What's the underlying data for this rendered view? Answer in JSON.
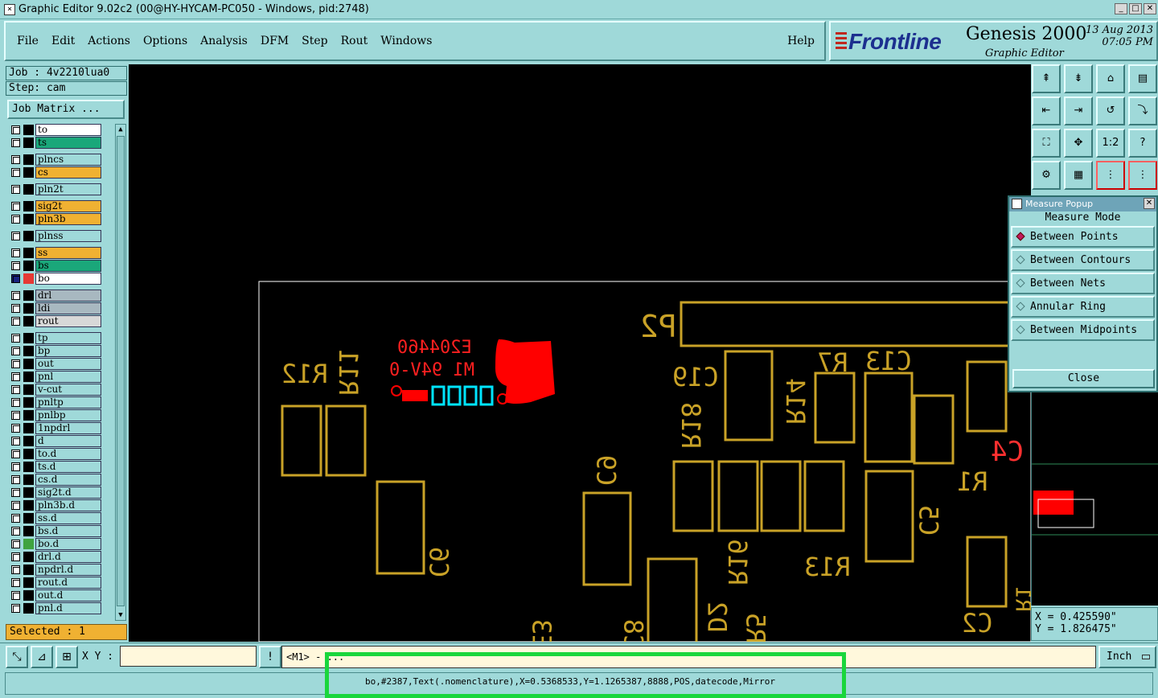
{
  "window": {
    "title": "Graphic Editor 9.02c2 (00@HY-HYCAM-PC050 - Windows, pid:2748)",
    "buttons": [
      "_",
      "□",
      "✕"
    ]
  },
  "menu": {
    "items": [
      "File",
      "Edit",
      "Actions",
      "Options",
      "Analysis",
      "DFM",
      "Step",
      "Rout",
      "Windows"
    ],
    "help": "Help"
  },
  "brand": {
    "logo": "Frontline",
    "product": "Genesis 2000",
    "subtitle": "Graphic Editor",
    "date": "13 Aug 2013",
    "time": "07:05 PM"
  },
  "job": {
    "job_line": "Job : 4v2210lua0",
    "step_line": "Step: cam",
    "matrix_button": "Job Matrix ..."
  },
  "layers": [
    {
      "name": "to",
      "color": "#ffffff"
    },
    {
      "name": "ts",
      "color": "#1aa77a"
    },
    {
      "name": "plncs",
      "color": "#9fd9d9"
    },
    {
      "name": "cs",
      "color": "#f0b132"
    },
    {
      "name": "pln2t",
      "color": "#9fd9d9"
    },
    {
      "name": "sig2t",
      "color": "#f0b132"
    },
    {
      "name": "pln3b",
      "color": "#f0b132"
    },
    {
      "name": "plnss",
      "color": "#9fd9d9"
    },
    {
      "name": "ss",
      "color": "#f0b132"
    },
    {
      "name": "bs",
      "color": "#1aa77a"
    },
    {
      "name": "bo",
      "color": "#ffffff",
      "active": true
    },
    {
      "name": "drl",
      "color": "#a8b8c0"
    },
    {
      "name": "ldi",
      "color": "#a8b8c0"
    },
    {
      "name": "rout",
      "color": "#d8d8d8"
    },
    {
      "name": "tp",
      "color": "#9fd9d9"
    },
    {
      "name": "bp",
      "color": "#9fd9d9"
    },
    {
      "name": "out",
      "color": "#9fd9d9"
    },
    {
      "name": "pnl",
      "color": "#9fd9d9"
    },
    {
      "name": "v-cut",
      "color": "#9fd9d9"
    },
    {
      "name": "pnltp",
      "color": "#9fd9d9"
    },
    {
      "name": "pnlbp",
      "color": "#9fd9d9"
    },
    {
      "name": "1npdrl",
      "color": "#9fd9d9"
    },
    {
      "name": "d",
      "color": "#9fd9d9"
    },
    {
      "name": "to.d",
      "color": "#9fd9d9"
    },
    {
      "name": "ts.d",
      "color": "#9fd9d9"
    },
    {
      "name": "cs.d",
      "color": "#9fd9d9"
    },
    {
      "name": "sig2t.d",
      "color": "#9fd9d9"
    },
    {
      "name": "pln3b.d",
      "color": "#9fd9d9"
    },
    {
      "name": "ss.d",
      "color": "#9fd9d9"
    },
    {
      "name": "bs.d",
      "color": "#9fd9d9"
    },
    {
      "name": "bo.d",
      "color": "#9fd9d9",
      "green_mark": true
    },
    {
      "name": "drl.d",
      "color": "#9fd9d9"
    },
    {
      "name": "npdrl.d",
      "color": "#9fd9d9"
    },
    {
      "name": "rout.d",
      "color": "#9fd9d9"
    },
    {
      "name": "out.d",
      "color": "#9fd9d9"
    },
    {
      "name": "pnl.d",
      "color": "#9fd9d9"
    }
  ],
  "selected_text": "Selected : 1",
  "canvas": {
    "labels": [
      "P2",
      "R12",
      "R11",
      "C19",
      "R18",
      "R14",
      "R7",
      "C13",
      "C4",
      "R1",
      "C6",
      "C9",
      "C5",
      "R16",
      "R13",
      "D2",
      "R5",
      "C2",
      "E3",
      "C8",
      "R1"
    ],
    "logo_text_1": "E204460",
    "logo_text_2": "M1 94V-0",
    "datecode": "8888"
  },
  "toolbar": {
    "tools": [
      "⇞",
      "⇟",
      "⌂",
      "▤",
      "⇤",
      "⇥",
      "↺",
      "⤵",
      "⛶",
      "✥",
      "1:2",
      "?",
      "⚙",
      "▦",
      "⋮",
      "⋮"
    ]
  },
  "measure": {
    "title": "Measure Popup",
    "mode_label": "Measure Mode",
    "options": [
      "Between Points",
      "Between Contours",
      "Between Nets",
      "Annular Ring",
      "Between Midpoints"
    ],
    "close": "Close"
  },
  "coords": {
    "x": "X = 0.425590\"",
    "y": "Y = 1.826475\""
  },
  "bottom": {
    "xy_label": "X Y :",
    "prompt": "<M1> - ...",
    "unit": "Inch",
    "status": "bo,#2387,Text(.nomenclature),X=0.5368533,Y=1.1265387,8888,POS,datecode,Mirror"
  },
  "colors": {
    "panel": "#9fd9d9",
    "canvas_bg": "#000000",
    "trace": "#c9a227",
    "selected_feature": "#ff0000",
    "highlight": "#19d63c"
  }
}
